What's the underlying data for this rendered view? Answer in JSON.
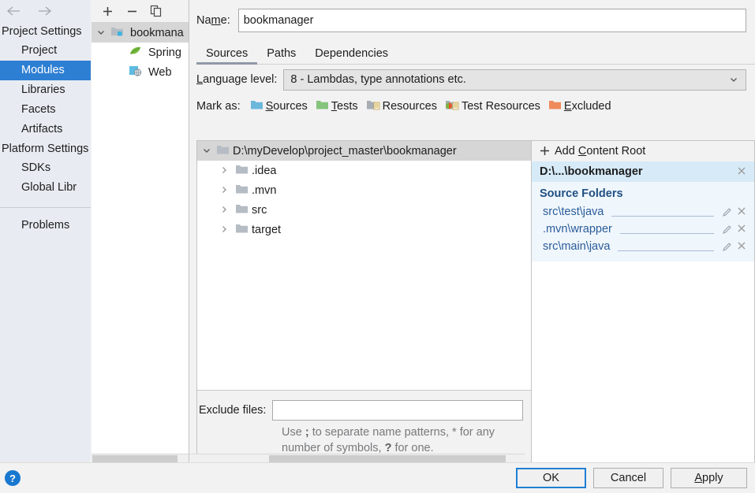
{
  "sidebar": {
    "back_icon": "arrow-left-icon",
    "forward_icon": "arrow-right-icon",
    "groups": [
      {
        "title": "Project Settings",
        "items": [
          {
            "label": "Project",
            "selected": false
          },
          {
            "label": "Modules",
            "selected": true
          },
          {
            "label": "Libraries",
            "selected": false
          },
          {
            "label": "Facets",
            "selected": false
          },
          {
            "label": "Artifacts",
            "selected": false
          }
        ]
      },
      {
        "title": "Platform Settings",
        "items": [
          {
            "label": "SDKs",
            "selected": false
          },
          {
            "label": "Global Libr",
            "selected": false
          }
        ]
      }
    ],
    "problems_label": "Problems",
    "selected_color": "#2d7fd3"
  },
  "modules_panel": {
    "toolbar": {
      "add_label": "+",
      "remove_label": "−",
      "copy_label": "copy-icon"
    },
    "tree": [
      {
        "label": "bookmana",
        "icon": "module-folder-icon",
        "selected": true,
        "expanded": true,
        "depth": 0
      },
      {
        "label": "Spring",
        "icon": "spring-leaf-icon",
        "selected": false,
        "depth": 1
      },
      {
        "label": "Web",
        "icon": "web-icon",
        "selected": false,
        "depth": 1
      }
    ]
  },
  "main": {
    "name_label": "Name:",
    "name_value": "bookmanager",
    "name_placeholder": "",
    "tabs": [
      {
        "label": "Sources",
        "active": true
      },
      {
        "label": "Paths",
        "active": false
      },
      {
        "label": "Dependencies",
        "active": false
      }
    ],
    "language_level_label": "Language level:",
    "language_level_value": "8 - Lambdas, type annotations etc.",
    "language_level_options": [
      "8 - Lambdas, type annotations etc."
    ],
    "mark_as_label": "Mark as:",
    "mark_as": [
      {
        "label": "Sources",
        "color": "#6cb7dc",
        "kind": "sources"
      },
      {
        "label": "Tests",
        "color": "#84c47c",
        "kind": "tests"
      },
      {
        "label": "Resources",
        "color": "#a7adb4",
        "kind": "resources"
      },
      {
        "label": "Test Resources",
        "color": "#a7adb4",
        "kind": "test-resources"
      },
      {
        "label": "Excluded",
        "color": "#ef8a5c",
        "kind": "excluded"
      }
    ],
    "file_tree": [
      {
        "label": "D:\\myDevelop\\project_master\\bookmanager",
        "selected": true,
        "expanded": true,
        "depth": 0
      },
      {
        "label": ".idea",
        "selected": false,
        "expanded": false,
        "depth": 1
      },
      {
        "label": ".mvn",
        "selected": false,
        "expanded": false,
        "depth": 1
      },
      {
        "label": "src",
        "selected": false,
        "expanded": false,
        "depth": 1
      },
      {
        "label": "target",
        "selected": false,
        "expanded": false,
        "depth": 1
      }
    ],
    "exclude_files_label": "Exclude files:",
    "exclude_files_value": "",
    "exclude_files_placeholder": "",
    "exclude_hint_line1_a": "Use ",
    "exclude_hint_line1_b": ";",
    "exclude_hint_line1_c": " to separate name patterns, ",
    "exclude_hint_line1_d": "*",
    "exclude_hint_line1_e": " for any",
    "exclude_hint_line2_a": "number of symbols, ",
    "exclude_hint_line2_b": "?",
    "exclude_hint_line2_c": " for one."
  },
  "right_panel": {
    "add_content_root_label": "Add Content Root",
    "content_root_label": "D:\\...\\bookmanager",
    "source_folders_label": "Source Folders",
    "source_folders": [
      {
        "path": "src\\test\\java"
      },
      {
        "path": ".mvn\\wrapper"
      },
      {
        "path": "src\\main\\java"
      }
    ],
    "highlight_color": "#d6eaf8",
    "section_bg": "#eff6fc",
    "link_color": "#2a5c99"
  },
  "footer": {
    "help_label": "?",
    "ok_label": "OK",
    "cancel_label": "Cancel",
    "apply_label": "Apply",
    "primary_color": "#1e7fd4"
  }
}
